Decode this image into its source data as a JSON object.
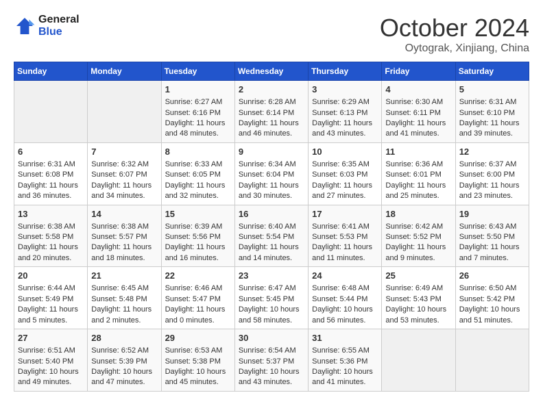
{
  "logo": {
    "line1": "General",
    "line2": "Blue"
  },
  "title": "October 2024",
  "location": "Oytograk, Xinjiang, China",
  "days_of_week": [
    "Sunday",
    "Monday",
    "Tuesday",
    "Wednesday",
    "Thursday",
    "Friday",
    "Saturday"
  ],
  "weeks": [
    [
      {
        "day": "",
        "sunrise": "",
        "sunset": "",
        "daylight": ""
      },
      {
        "day": "",
        "sunrise": "",
        "sunset": "",
        "daylight": ""
      },
      {
        "day": "1",
        "sunrise": "Sunrise: 6:27 AM",
        "sunset": "Sunset: 6:16 PM",
        "daylight": "Daylight: 11 hours and 48 minutes."
      },
      {
        "day": "2",
        "sunrise": "Sunrise: 6:28 AM",
        "sunset": "Sunset: 6:14 PM",
        "daylight": "Daylight: 11 hours and 46 minutes."
      },
      {
        "day": "3",
        "sunrise": "Sunrise: 6:29 AM",
        "sunset": "Sunset: 6:13 PM",
        "daylight": "Daylight: 11 hours and 43 minutes."
      },
      {
        "day": "4",
        "sunrise": "Sunrise: 6:30 AM",
        "sunset": "Sunset: 6:11 PM",
        "daylight": "Daylight: 11 hours and 41 minutes."
      },
      {
        "day": "5",
        "sunrise": "Sunrise: 6:31 AM",
        "sunset": "Sunset: 6:10 PM",
        "daylight": "Daylight: 11 hours and 39 minutes."
      }
    ],
    [
      {
        "day": "6",
        "sunrise": "Sunrise: 6:31 AM",
        "sunset": "Sunset: 6:08 PM",
        "daylight": "Daylight: 11 hours and 36 minutes."
      },
      {
        "day": "7",
        "sunrise": "Sunrise: 6:32 AM",
        "sunset": "Sunset: 6:07 PM",
        "daylight": "Daylight: 11 hours and 34 minutes."
      },
      {
        "day": "8",
        "sunrise": "Sunrise: 6:33 AM",
        "sunset": "Sunset: 6:05 PM",
        "daylight": "Daylight: 11 hours and 32 minutes."
      },
      {
        "day": "9",
        "sunrise": "Sunrise: 6:34 AM",
        "sunset": "Sunset: 6:04 PM",
        "daylight": "Daylight: 11 hours and 30 minutes."
      },
      {
        "day": "10",
        "sunrise": "Sunrise: 6:35 AM",
        "sunset": "Sunset: 6:03 PM",
        "daylight": "Daylight: 11 hours and 27 minutes."
      },
      {
        "day": "11",
        "sunrise": "Sunrise: 6:36 AM",
        "sunset": "Sunset: 6:01 PM",
        "daylight": "Daylight: 11 hours and 25 minutes."
      },
      {
        "day": "12",
        "sunrise": "Sunrise: 6:37 AM",
        "sunset": "Sunset: 6:00 PM",
        "daylight": "Daylight: 11 hours and 23 minutes."
      }
    ],
    [
      {
        "day": "13",
        "sunrise": "Sunrise: 6:38 AM",
        "sunset": "Sunset: 5:58 PM",
        "daylight": "Daylight: 11 hours and 20 minutes."
      },
      {
        "day": "14",
        "sunrise": "Sunrise: 6:38 AM",
        "sunset": "Sunset: 5:57 PM",
        "daylight": "Daylight: 11 hours and 18 minutes."
      },
      {
        "day": "15",
        "sunrise": "Sunrise: 6:39 AM",
        "sunset": "Sunset: 5:56 PM",
        "daylight": "Daylight: 11 hours and 16 minutes."
      },
      {
        "day": "16",
        "sunrise": "Sunrise: 6:40 AM",
        "sunset": "Sunset: 5:54 PM",
        "daylight": "Daylight: 11 hours and 14 minutes."
      },
      {
        "day": "17",
        "sunrise": "Sunrise: 6:41 AM",
        "sunset": "Sunset: 5:53 PM",
        "daylight": "Daylight: 11 hours and 11 minutes."
      },
      {
        "day": "18",
        "sunrise": "Sunrise: 6:42 AM",
        "sunset": "Sunset: 5:52 PM",
        "daylight": "Daylight: 11 hours and 9 minutes."
      },
      {
        "day": "19",
        "sunrise": "Sunrise: 6:43 AM",
        "sunset": "Sunset: 5:50 PM",
        "daylight": "Daylight: 11 hours and 7 minutes."
      }
    ],
    [
      {
        "day": "20",
        "sunrise": "Sunrise: 6:44 AM",
        "sunset": "Sunset: 5:49 PM",
        "daylight": "Daylight: 11 hours and 5 minutes."
      },
      {
        "day": "21",
        "sunrise": "Sunrise: 6:45 AM",
        "sunset": "Sunset: 5:48 PM",
        "daylight": "Daylight: 11 hours and 2 minutes."
      },
      {
        "day": "22",
        "sunrise": "Sunrise: 6:46 AM",
        "sunset": "Sunset: 5:47 PM",
        "daylight": "Daylight: 11 hours and 0 minutes."
      },
      {
        "day": "23",
        "sunrise": "Sunrise: 6:47 AM",
        "sunset": "Sunset: 5:45 PM",
        "daylight": "Daylight: 10 hours and 58 minutes."
      },
      {
        "day": "24",
        "sunrise": "Sunrise: 6:48 AM",
        "sunset": "Sunset: 5:44 PM",
        "daylight": "Daylight: 10 hours and 56 minutes."
      },
      {
        "day": "25",
        "sunrise": "Sunrise: 6:49 AM",
        "sunset": "Sunset: 5:43 PM",
        "daylight": "Daylight: 10 hours and 53 minutes."
      },
      {
        "day": "26",
        "sunrise": "Sunrise: 6:50 AM",
        "sunset": "Sunset: 5:42 PM",
        "daylight": "Daylight: 10 hours and 51 minutes."
      }
    ],
    [
      {
        "day": "27",
        "sunrise": "Sunrise: 6:51 AM",
        "sunset": "Sunset: 5:40 PM",
        "daylight": "Daylight: 10 hours and 49 minutes."
      },
      {
        "day": "28",
        "sunrise": "Sunrise: 6:52 AM",
        "sunset": "Sunset: 5:39 PM",
        "daylight": "Daylight: 10 hours and 47 minutes."
      },
      {
        "day": "29",
        "sunrise": "Sunrise: 6:53 AM",
        "sunset": "Sunset: 5:38 PM",
        "daylight": "Daylight: 10 hours and 45 minutes."
      },
      {
        "day": "30",
        "sunrise": "Sunrise: 6:54 AM",
        "sunset": "Sunset: 5:37 PM",
        "daylight": "Daylight: 10 hours and 43 minutes."
      },
      {
        "day": "31",
        "sunrise": "Sunrise: 6:55 AM",
        "sunset": "Sunset: 5:36 PM",
        "daylight": "Daylight: 10 hours and 41 minutes."
      },
      {
        "day": "",
        "sunrise": "",
        "sunset": "",
        "daylight": ""
      },
      {
        "day": "",
        "sunrise": "",
        "sunset": "",
        "daylight": ""
      }
    ]
  ]
}
